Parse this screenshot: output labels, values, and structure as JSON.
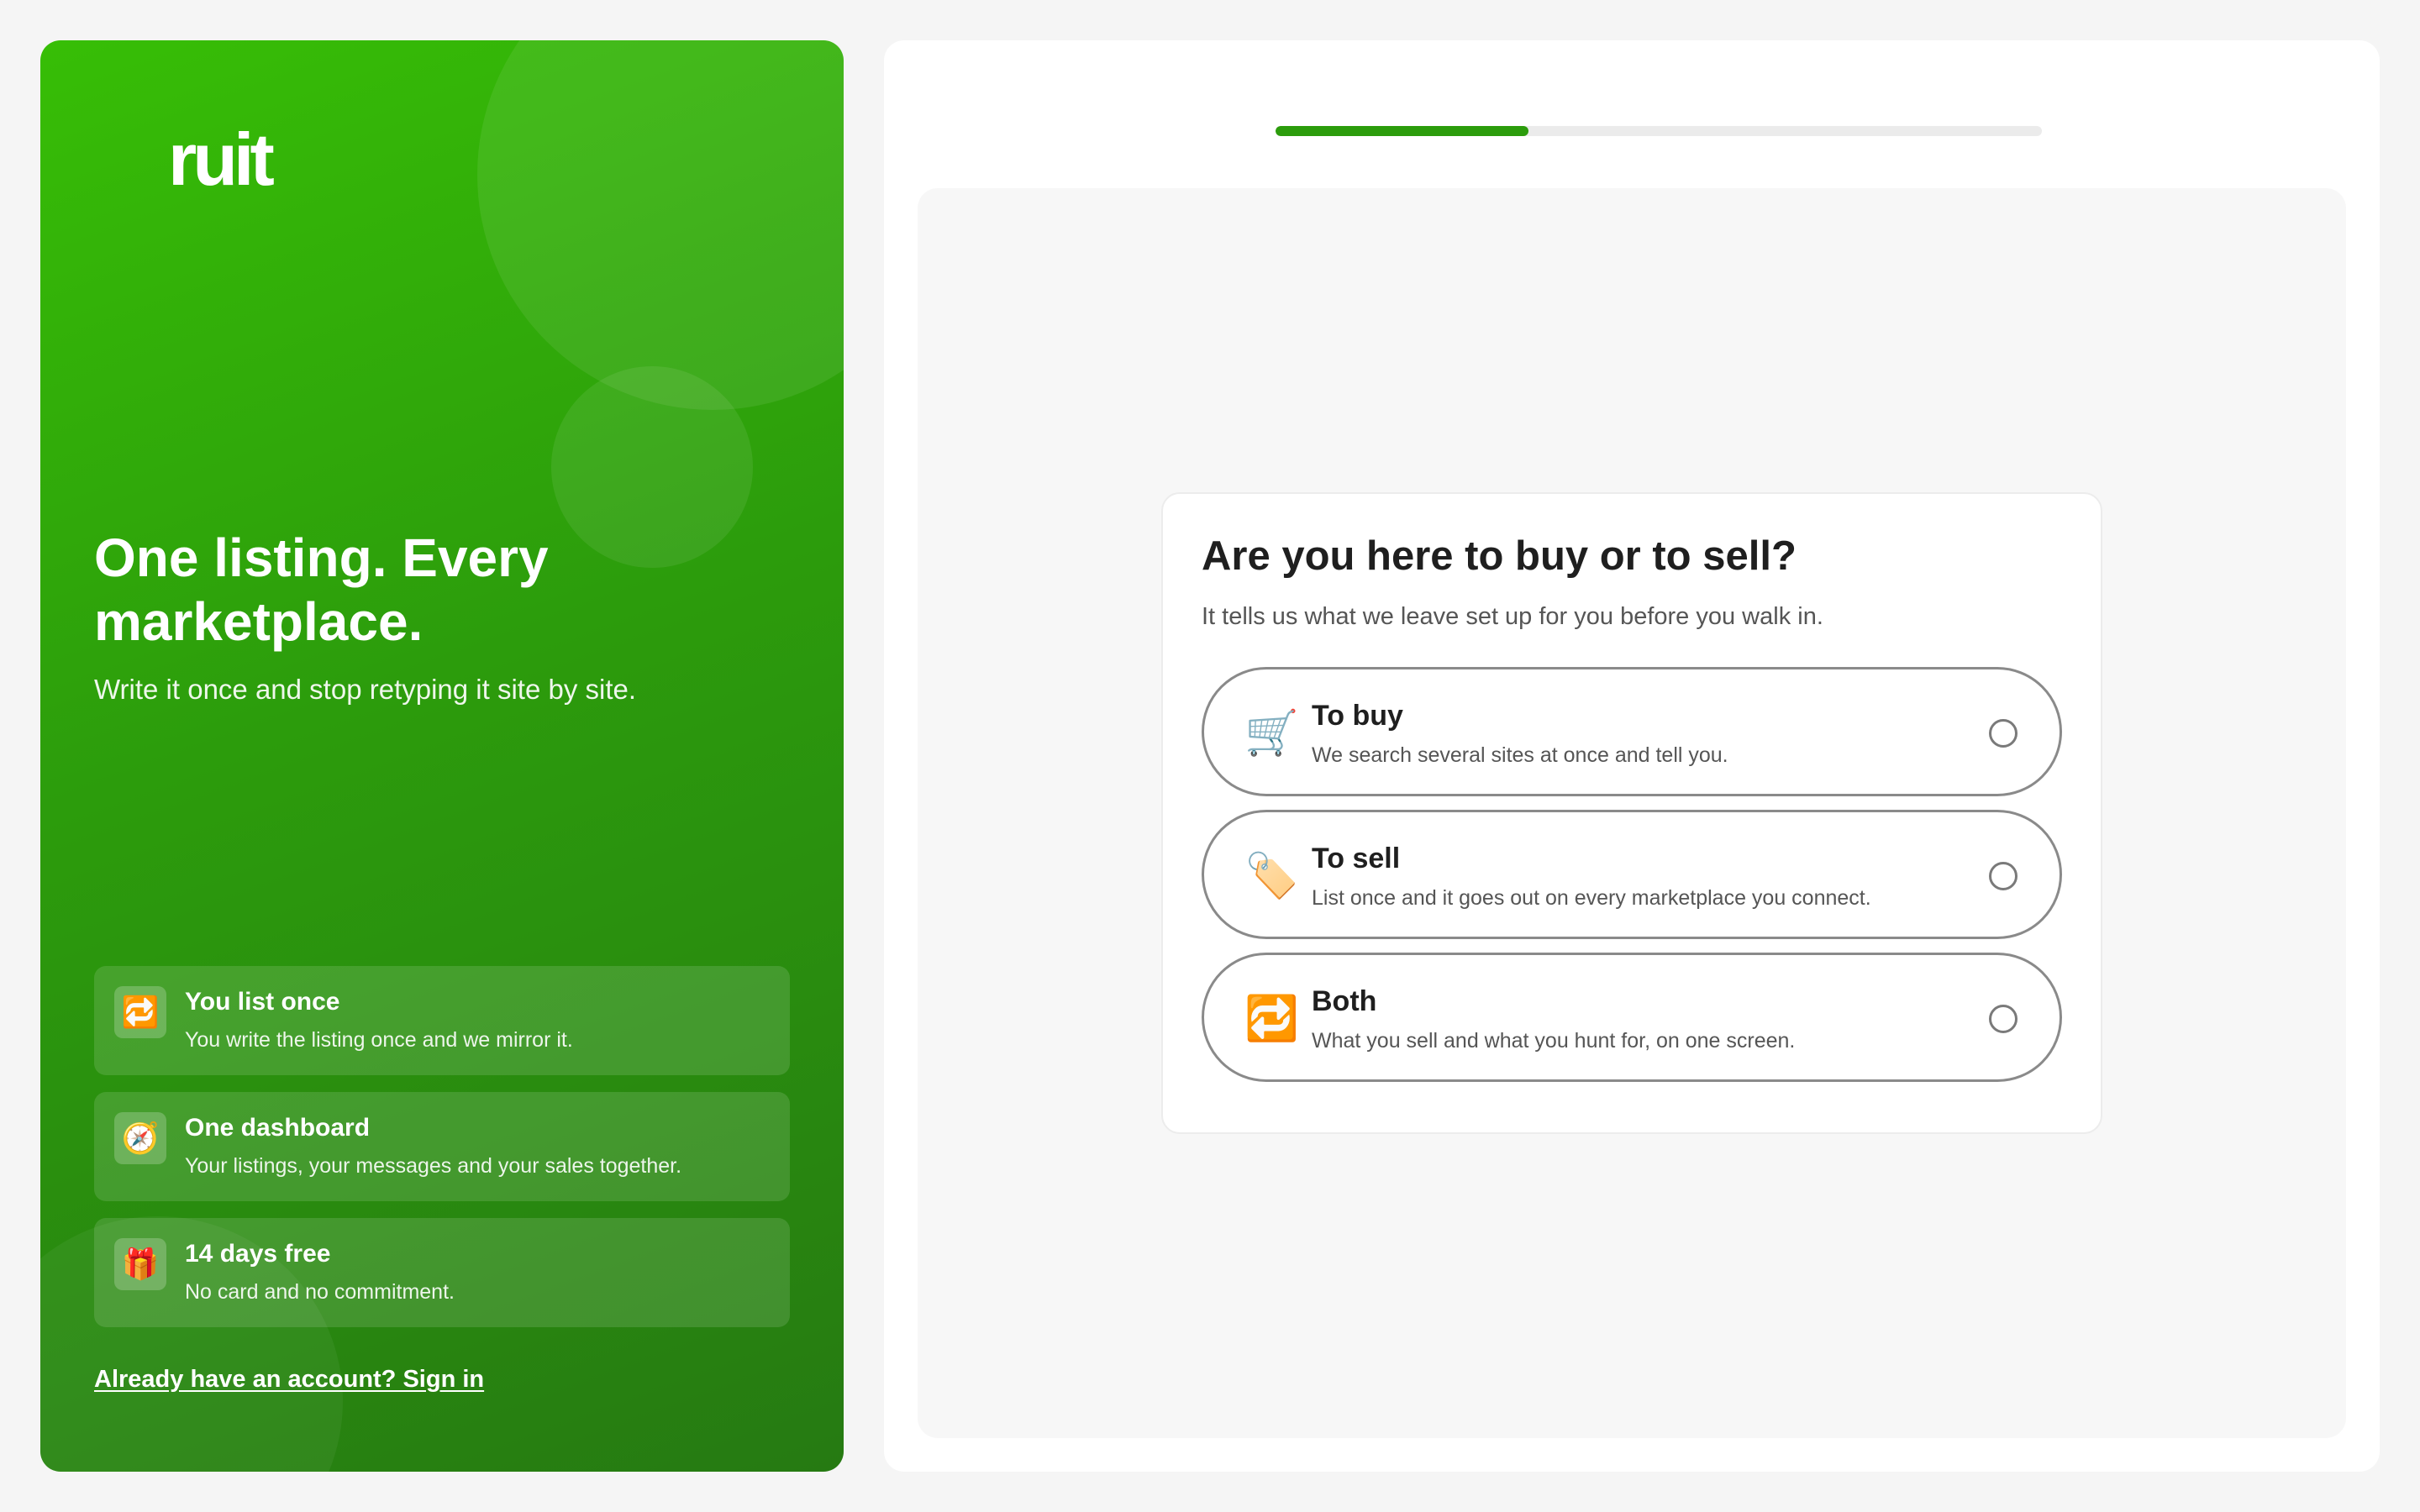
{
  "brand": {
    "logo_text": "ruit",
    "accent_color": "#2c9c0c"
  },
  "hero": {
    "title": "One listing. Every marketplace.",
    "subtitle": "Write it once and stop retyping it site by site."
  },
  "features": [
    {
      "icon": "repeat-icon",
      "icon_glyph": "🔁",
      "title": "You list once",
      "description": "You write the listing once and we mirror it."
    },
    {
      "icon": "compass-icon",
      "icon_glyph": "🧭",
      "title": "One dashboard",
      "description": "Your listings, your messages and your sales together."
    },
    {
      "icon": "gift-icon",
      "icon_glyph": "🎁",
      "title": "14 days free",
      "description": "No card and no commitment."
    }
  ],
  "signin": {
    "label": "Already have an account? Sign in"
  },
  "progress": {
    "value": 0.33
  },
  "question": {
    "title": "Are you here to buy or to sell?",
    "subtitle": "It tells us what we leave set up for you before you walk in.",
    "options": [
      {
        "icon": "shopping-cart-icon",
        "icon_glyph": "🛒",
        "title": "To buy",
        "description": "We search several sites at once and tell you.",
        "selected": false
      },
      {
        "icon": "price-tag-icon",
        "icon_glyph": "🏷️",
        "title": "To sell",
        "description": "List once and it goes out on every marketplace you connect.",
        "selected": false
      },
      {
        "icon": "repeat-icon",
        "icon_glyph": "🔁",
        "title": "Both",
        "description": "What you sell and what you hunt for, on one screen.",
        "selected": false
      }
    ]
  }
}
